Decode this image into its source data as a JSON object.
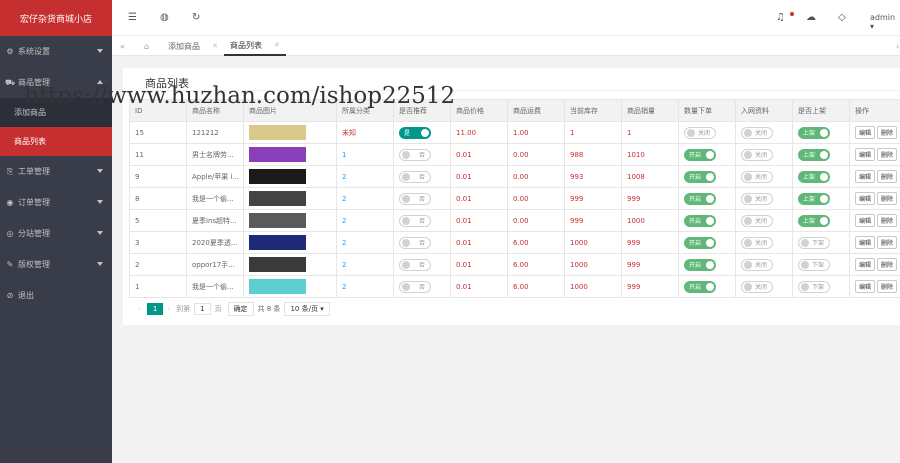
{
  "app": {
    "title": "宏仔杂货商城小店"
  },
  "sidebar": {
    "items": [
      {
        "label": "系统设置",
        "icon": "gear-icon",
        "expanded": false
      },
      {
        "label": "商品管理",
        "icon": "cart-icon",
        "expanded": true,
        "children": [
          {
            "label": "添加商品",
            "active": false
          },
          {
            "label": "商品列表",
            "active": true
          }
        ]
      },
      {
        "label": "工单管理",
        "icon": "ticket-icon",
        "expanded": false
      },
      {
        "label": "订单管理",
        "icon": "order-icon",
        "expanded": false
      },
      {
        "label": "分站管理",
        "icon": "site-icon",
        "expanded": false
      },
      {
        "label": "版权管理",
        "icon": "copyright-icon",
        "expanded": false
      },
      {
        "label": "退出",
        "icon": "logout-icon"
      }
    ]
  },
  "topbar": {
    "user": "admin ▾",
    "icons": [
      "menu-icon",
      "globe-icon",
      "refresh-icon",
      "bell-icon",
      "theme-icon",
      "tag-icon"
    ]
  },
  "tabs": [
    {
      "label": "添加商品",
      "active": false
    },
    {
      "label": "商品列表",
      "active": true
    }
  ],
  "card": {
    "title": "商品列表"
  },
  "table": {
    "headers": [
      "ID",
      "商品名称",
      "商品图片",
      "所属分类",
      "是否推荐",
      "商品价格",
      "商品运费",
      "当前库存",
      "商品销量",
      "数量下单",
      "入网资料",
      "是否上架",
      "操作"
    ],
    "rows": [
      {
        "id": "15",
        "name": "121212",
        "img": "#d9c98a",
        "cat": "未知",
        "rec": "是",
        "price": "11.00",
        "ship": "1.00",
        "stock": "1",
        "sales": "1",
        "qty": "关闭",
        "net": "关闭",
        "shelf": "上架"
      },
      {
        "id": "11",
        "name": "男士名牌劳...",
        "img": "#8a3fb8",
        "cat": "1",
        "rec": "否",
        "price": "0.01",
        "ship": "0.00",
        "stock": "988",
        "sales": "1010",
        "qty": "开启",
        "net": "关闭",
        "shelf": "上架"
      },
      {
        "id": "9",
        "name": "Apple/苹果 i...",
        "img": "#1a1a1a",
        "cat": "2",
        "rec": "否",
        "price": "0.01",
        "ship": "0.00",
        "stock": "993",
        "sales": "1008",
        "qty": "开启",
        "net": "关闭",
        "shelf": "上架"
      },
      {
        "id": "8",
        "name": "我是一个偷...",
        "img": "#444444",
        "cat": "2",
        "rec": "否",
        "price": "0.01",
        "ship": "0.00",
        "stock": "999",
        "sales": "999",
        "qty": "开启",
        "net": "关闭",
        "shelf": "上架"
      },
      {
        "id": "5",
        "name": "夏季ins超特...",
        "img": "#5a5a5a",
        "cat": "2",
        "rec": "否",
        "price": "0.01",
        "ship": "0.00",
        "stock": "999",
        "sales": "1000",
        "qty": "开启",
        "net": "关闭",
        "shelf": "上架"
      },
      {
        "id": "3",
        "name": "2020夏季透...",
        "img": "#1f2a7a",
        "cat": "2",
        "rec": "否",
        "price": "0.01",
        "ship": "6.00",
        "stock": "1000",
        "sales": "999",
        "qty": "开启",
        "net": "关闭",
        "shelf": "下架"
      },
      {
        "id": "2",
        "name": "oppor17手...",
        "img": "#3a3a3a",
        "cat": "2",
        "rec": "否",
        "price": "0.01",
        "ship": "6.00",
        "stock": "1000",
        "sales": "999",
        "qty": "开启",
        "net": "关闭",
        "shelf": "下架"
      },
      {
        "id": "1",
        "name": "我是一个偷...",
        "img": "#5ccfd0",
        "cat": "2",
        "rec": "否",
        "price": "0.01",
        "ship": "6.00",
        "stock": "1000",
        "sales": "999",
        "qty": "开启",
        "net": "关闭",
        "shelf": "下架"
      }
    ],
    "actions": [
      "编辑",
      "删除"
    ]
  },
  "pager": {
    "current": "1",
    "goto_label": "到第",
    "page_input": "1",
    "page_unit": "页",
    "confirm": "确定",
    "total": "共 8 条",
    "per_page": "10 条/页"
  },
  "watermark": "https://www.huzhan.com/ishop22512",
  "colors": {
    "sidebar": "#393d49",
    "brand": "#c62f2f",
    "switch_on": "#5fb878",
    "accent": "#009688"
  }
}
